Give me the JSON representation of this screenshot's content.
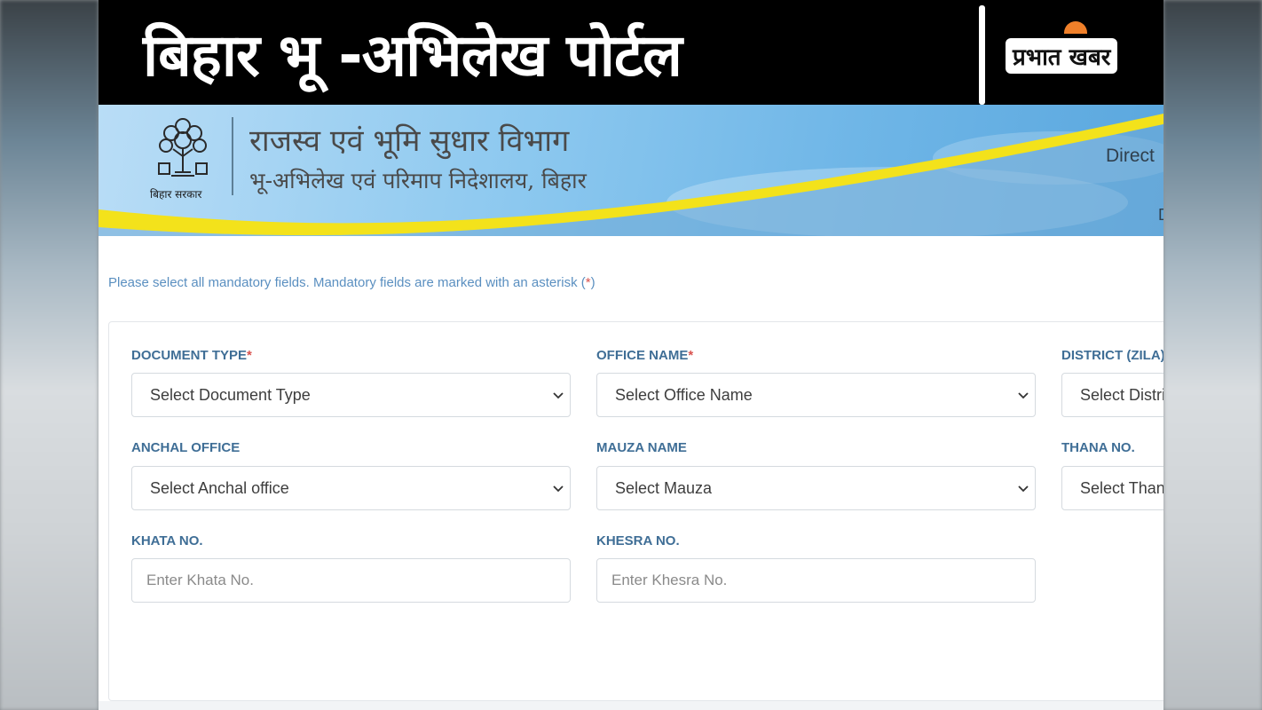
{
  "header": {
    "title": "बिहार भू -अभिलेख पोर्टल",
    "brand": "प्रभात खबर"
  },
  "banner": {
    "emblem_caption": "बिहार सरकार",
    "dept_line1": "राजस्व एवं भूमि सुधार विभाग",
    "dept_line2": "भू-अभिलेख एवं परिमाप निदेशालय, बिहार",
    "right_text_1": "Direct",
    "right_text_2": "D"
  },
  "form": {
    "notice": "Please select all mandatory fields. Mandatory fields are marked with an asterisk (",
    "notice_star": "*",
    "notice_end": ")",
    "fields": {
      "document_type": {
        "label": "DOCUMENT TYPE",
        "required": "*",
        "value": "Select Document Type"
      },
      "office_name": {
        "label": "OFFICE NAME",
        "required": "*",
        "value": "Select Office Name"
      },
      "district": {
        "label": "DISTRICT (ZILA)",
        "value": "Select District"
      },
      "anchal_office": {
        "label": "ANCHAL OFFICE",
        "value": "Select Anchal office"
      },
      "mauza_name": {
        "label": "MAUZA NAME",
        "value": "Select Mauza"
      },
      "thana_no": {
        "label": "THANA NO.",
        "value": "Select Thana"
      },
      "khata_no": {
        "label": "KHATA NO.",
        "placeholder": "Enter Khata No."
      },
      "khesra_no": {
        "label": "KHESRA NO.",
        "placeholder": "Enter Khesra No."
      }
    }
  },
  "colors": {
    "label": "#3f6e96",
    "notice": "#5a8fc0",
    "required": "#d9534f",
    "banner_blue": "#6fb6e7",
    "banner_yellow": "#f3e21b"
  }
}
